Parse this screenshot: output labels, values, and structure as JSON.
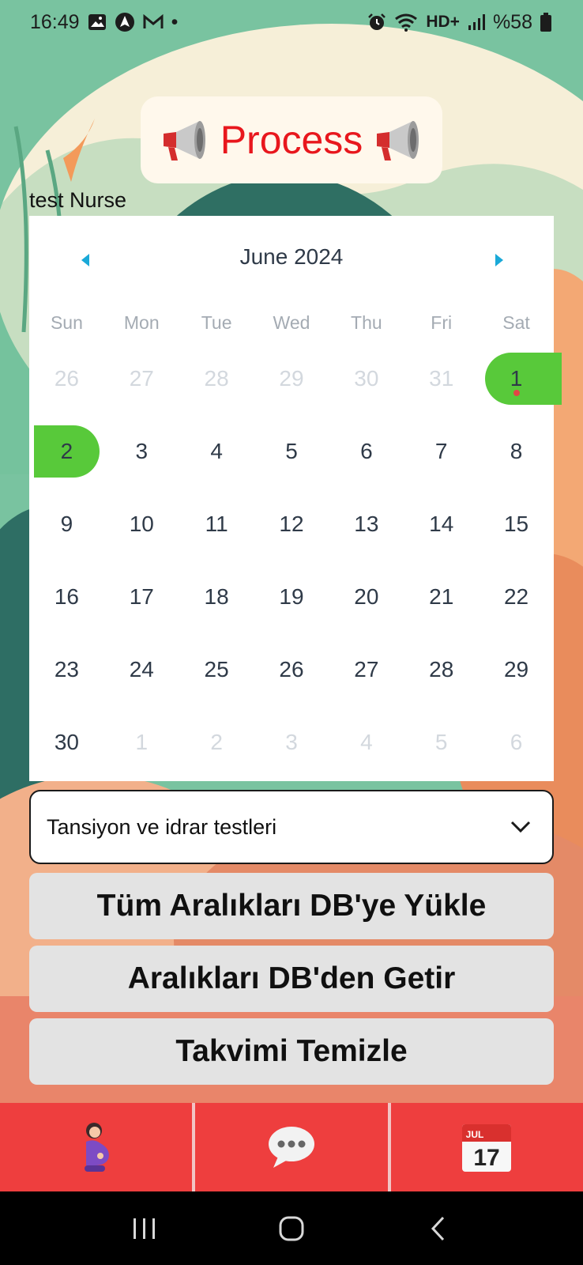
{
  "status_bar": {
    "time": "16:49",
    "dot": "•",
    "network": "HD+",
    "battery": "%58",
    "left_icons": [
      "image-icon",
      "navigation-icon",
      "mail-icon"
    ],
    "right_icons": [
      "alarm-icon",
      "wifi-icon",
      "signal-icon",
      "battery-icon"
    ]
  },
  "title": {
    "text": "Process",
    "icon": "megaphone-icon",
    "color": "#e8171d"
  },
  "user_label": "test Nurse",
  "calendar": {
    "month_label": "June 2024",
    "weekdays": [
      "Sun",
      "Mon",
      "Tue",
      "Wed",
      "Thu",
      "Fri",
      "Sat"
    ],
    "weeks": [
      [
        "26",
        "27",
        "28",
        "29",
        "30",
        "31",
        "1"
      ],
      [
        "2",
        "3",
        "4",
        "5",
        "6",
        "7",
        "8"
      ],
      [
        "9",
        "10",
        "11",
        "12",
        "13",
        "14",
        "15"
      ],
      [
        "16",
        "17",
        "18",
        "19",
        "20",
        "21",
        "22"
      ],
      [
        "23",
        "24",
        "25",
        "26",
        "27",
        "28",
        "29"
      ],
      [
        "30",
        "1",
        "2",
        "3",
        "4",
        "5",
        "6"
      ]
    ],
    "selected_range_days": [
      "1",
      "2"
    ],
    "marked_day": "1",
    "selection_color": "#58c93a",
    "marker_color": "#e14646",
    "arrow_color": "#1aa9d8"
  },
  "dropdown": {
    "value": "Tansiyon ve idrar testleri"
  },
  "buttons": {
    "upload_all": "Tüm Aralıkları DB'ye Yükle",
    "fetch": "Aralıkları DB'den Getir",
    "clear": "Takvimi Temizle"
  },
  "bottom_nav": {
    "items": [
      {
        "icon": "pregnant-woman-icon"
      },
      {
        "icon": "speech-bubble-icon"
      },
      {
        "icon": "calendar-icon",
        "month": "JUL",
        "day": "17"
      }
    ],
    "background": "#ee3e3e"
  },
  "system_nav": {
    "icons": [
      "recent-apps-icon",
      "home-icon",
      "back-icon"
    ]
  }
}
